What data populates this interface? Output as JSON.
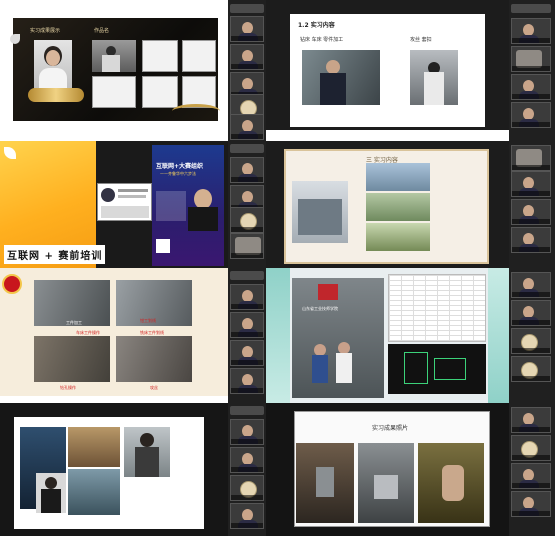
{
  "grid": {
    "cell1": {
      "label_left": "实习成果展示",
      "label_right": "作品名"
    },
    "cell2": {
      "title": "1.2 实习内容",
      "sub_left": "钻床 车床 零件加工",
      "sub_right": "攻丝 套扣"
    },
    "cell3": {
      "banner": "互联网 + 赛前培训",
      "poster_title": "互联网+大赛组织",
      "poster_sub": "——齐鲁华中六步法"
    },
    "cell4": {
      "title": "三 实习内容"
    },
    "cell5": {
      "captions": [
        "工件加工",
        "钳工划线",
        "车床工件操作",
        "铣床工件划线",
        "钻孔操作",
        "攻丝"
      ]
    },
    "cell6": {
      "sign_text": "山东省工业技师学院"
    },
    "cell8": {
      "title": "实习成果照片"
    }
  }
}
